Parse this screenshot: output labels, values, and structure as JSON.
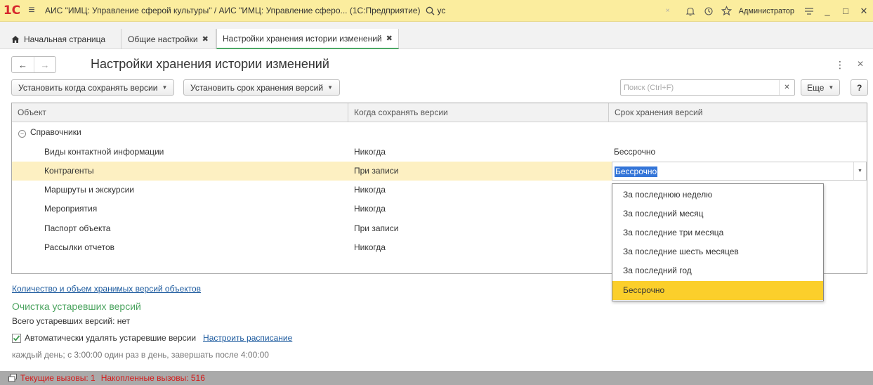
{
  "window": {
    "logo": "1С",
    "title": "АИС \"ИМЦ: Управление сферой культуры\" / АИС \"ИМЦ: Управление сферо...  (1С:Предприятие)",
    "search_text": "ус",
    "user": "Администратор"
  },
  "tabs": [
    {
      "label": "Начальная страница"
    },
    {
      "label": "Общие настройки"
    },
    {
      "label": "Настройки хранения истории изменений"
    }
  ],
  "form": {
    "title": "Настройки хранения истории изменений",
    "btn_when_save": "Установить когда сохранять версии",
    "btn_retention": "Установить срок хранения версий",
    "search_placeholder": "Поиск (Ctrl+F)",
    "more_label": "Еще",
    "help_label": "?"
  },
  "table": {
    "columns": [
      "Объект",
      "Когда сохранять версии",
      "Срок хранения версий"
    ],
    "group": "Справочники",
    "rows": [
      {
        "object": "Виды контактной информации",
        "when": "Никогда",
        "term": "Бессрочно"
      },
      {
        "object": "Контрагенты",
        "when": "При записи",
        "term": "Бессрочно"
      },
      {
        "object": "Маршруты и экскурсии",
        "when": "Никогда",
        "term": ""
      },
      {
        "object": "Мероприятия",
        "when": "Никогда",
        "term": ""
      },
      {
        "object": "Паспорт объекта",
        "when": "При записи",
        "term": ""
      },
      {
        "object": "Рассылки отчетов",
        "when": "Никогда",
        "term": ""
      }
    ],
    "selected_row": 1
  },
  "dropdown": {
    "options": [
      "За последнюю неделю",
      "За последний месяц",
      "За последние три месяца",
      "За последние шесть месяцев",
      "За последний год",
      "Бессрочно"
    ],
    "selected": 5
  },
  "bottom": {
    "versions_link": "Количество и объем хранимых версий объектов",
    "cleanup_title": "Очистка устаревших версий",
    "total_outdated": "Всего устаревших версий: нет",
    "auto_delete_label": "Автоматически удалять устаревшие версии",
    "auto_delete_checked": true,
    "schedule_link": "Настроить расписание",
    "schedule_text": "каждый день; с 3:00:00 один раз в день, завершать после 4:00:00"
  },
  "status": {
    "current_calls": "Текущие вызовы: 1",
    "accumulated_calls": "Накопленные вызовы: 516"
  },
  "colors": {
    "titlebar": "#fbed9e",
    "selected_row": "#fdf0c2",
    "dropdown_selected": "#fbcf2b",
    "link": "#1c5a9e",
    "section_title": "#4aa35e",
    "status_text": "#d51a1a"
  }
}
